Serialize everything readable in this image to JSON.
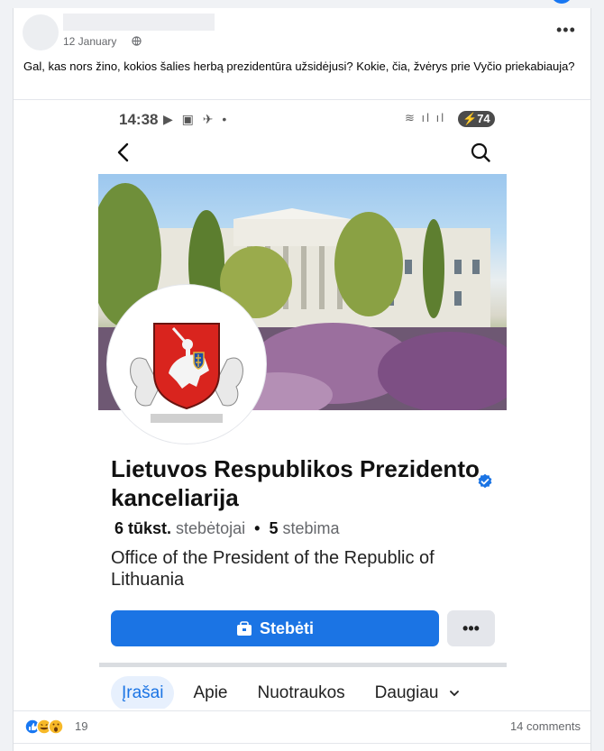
{
  "post": {
    "date": "12 January",
    "text": "Gal, kas nors žino, kokios šalies herbą prezidentūra užsidėjusi? Kokie, čia, žvėrys prie Vyčio priekabiauja?",
    "reaction_count": "19",
    "comments": "14 comments"
  },
  "phone": {
    "time": "14:38",
    "battery": "74"
  },
  "page": {
    "title": "Lietuvos Respublikos Prezidento kanceliarija",
    "followers_count": "6 tūkst.",
    "followers_label": "stebėtojai",
    "following_count": "5",
    "following_label": "stebima",
    "description": "Office of the President of the Republic of Lithuania",
    "follow_label": "Stebėti",
    "more_label": "•••",
    "tabs": [
      {
        "label": "Įrašai",
        "active": true
      },
      {
        "label": "Apie",
        "active": false
      },
      {
        "label": "Nuotraukos",
        "active": false
      },
      {
        "label": "Daugiau",
        "active": false
      }
    ]
  },
  "colors": {
    "accent": "#1b74e4",
    "verified": "#1b74e4",
    "coat_red": "#d9241e"
  },
  "icons": [
    "globe-icon",
    "more-icon",
    "back-chevron-icon",
    "search-icon",
    "verified-icon",
    "follow-icon",
    "chevron-down-icon",
    "like-icon",
    "haha-icon",
    "wow-icon"
  ]
}
